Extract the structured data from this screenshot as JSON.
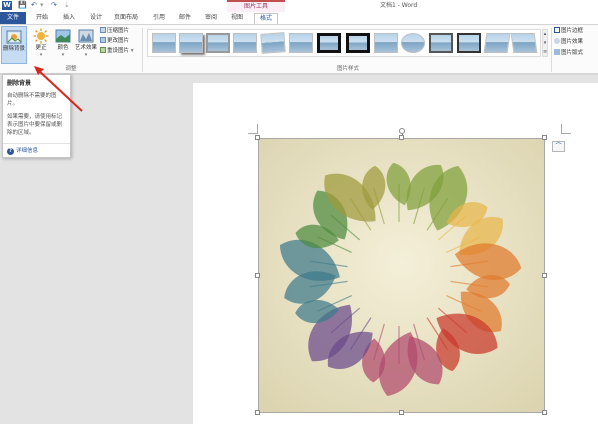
{
  "title_bar": {
    "app_icon_letter": "W",
    "save_icon": "save-icon",
    "undo_icon": "undo-icon",
    "redo_icon": "redo-icon",
    "contextual_group": "图片工具",
    "document_title": "文档1 - Word"
  },
  "tabs": [
    "文件",
    "开始",
    "插入",
    "设计",
    "页面布局",
    "引用",
    "邮件",
    "审阅",
    "视图",
    "格式"
  ],
  "active_tab": "格式",
  "ribbon": {
    "remove_background": "删除背景",
    "corrections": "更正",
    "color": "颜色",
    "artistic_effects": "艺术效果",
    "compress": "压缩图片",
    "change_picture": "更改图片",
    "reset_picture": "重设图片",
    "adjust_group": "调整",
    "styles_group": "图片样式",
    "picture_border": "图片边框",
    "picture_effects": "图片效果",
    "picture_layout": "图片版式",
    "gallery_scroll_down": "▾"
  },
  "tooltip": {
    "title": "删除背景",
    "body1": "自动删除不需要的图片。",
    "body2": "如果需要，请使用标记表示图片中要保留或删除的区域。",
    "more": "详细信息",
    "help_glyph": "?"
  },
  "picture": {
    "layout_options_glyph": "⌒",
    "description_colors": [
      "#7fa03a",
      "#e8b54a",
      "#e07a2d",
      "#c9382b",
      "#b04a6c",
      "#6b4a8a",
      "#3f7a8a",
      "#4e8a3f",
      "#9e9a3a"
    ]
  }
}
